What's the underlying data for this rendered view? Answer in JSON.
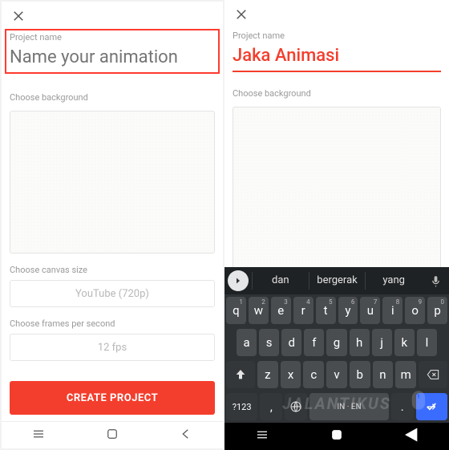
{
  "left": {
    "project_name_label": "Project name",
    "project_name_placeholder": "Name your animation",
    "choose_bg_label": "Choose background",
    "canvas_size_label": "Choose canvas size",
    "canvas_size_value": "YouTube (720p)",
    "fps_label": "Choose frames per second",
    "fps_value": "12 fps",
    "create_btn": "CREATE PROJECT"
  },
  "right": {
    "project_name_label": "Project name",
    "project_name_value": "Jaka Animasi",
    "choose_bg_label": "Choose background"
  },
  "keyboard": {
    "suggestions": [
      "dan",
      "bergerak",
      "yang"
    ],
    "row1": [
      {
        "k": "q",
        "n": "1"
      },
      {
        "k": "w",
        "n": "2"
      },
      {
        "k": "e",
        "n": "3"
      },
      {
        "k": "r",
        "n": "4"
      },
      {
        "k": "t",
        "n": "5"
      },
      {
        "k": "y",
        "n": "6"
      },
      {
        "k": "u",
        "n": "7"
      },
      {
        "k": "i",
        "n": "8"
      },
      {
        "k": "o",
        "n": "9"
      },
      {
        "k": "p",
        "n": "0"
      }
    ],
    "row2": [
      "a",
      "s",
      "d",
      "f",
      "g",
      "h",
      "j",
      "k",
      "l"
    ],
    "row3": [
      "z",
      "x",
      "c",
      "v",
      "b",
      "n",
      "m"
    ],
    "sym": "?123",
    "lang": "IN · EN",
    "comma": ",",
    "period": "."
  },
  "watermark": "JALANTIKUS"
}
